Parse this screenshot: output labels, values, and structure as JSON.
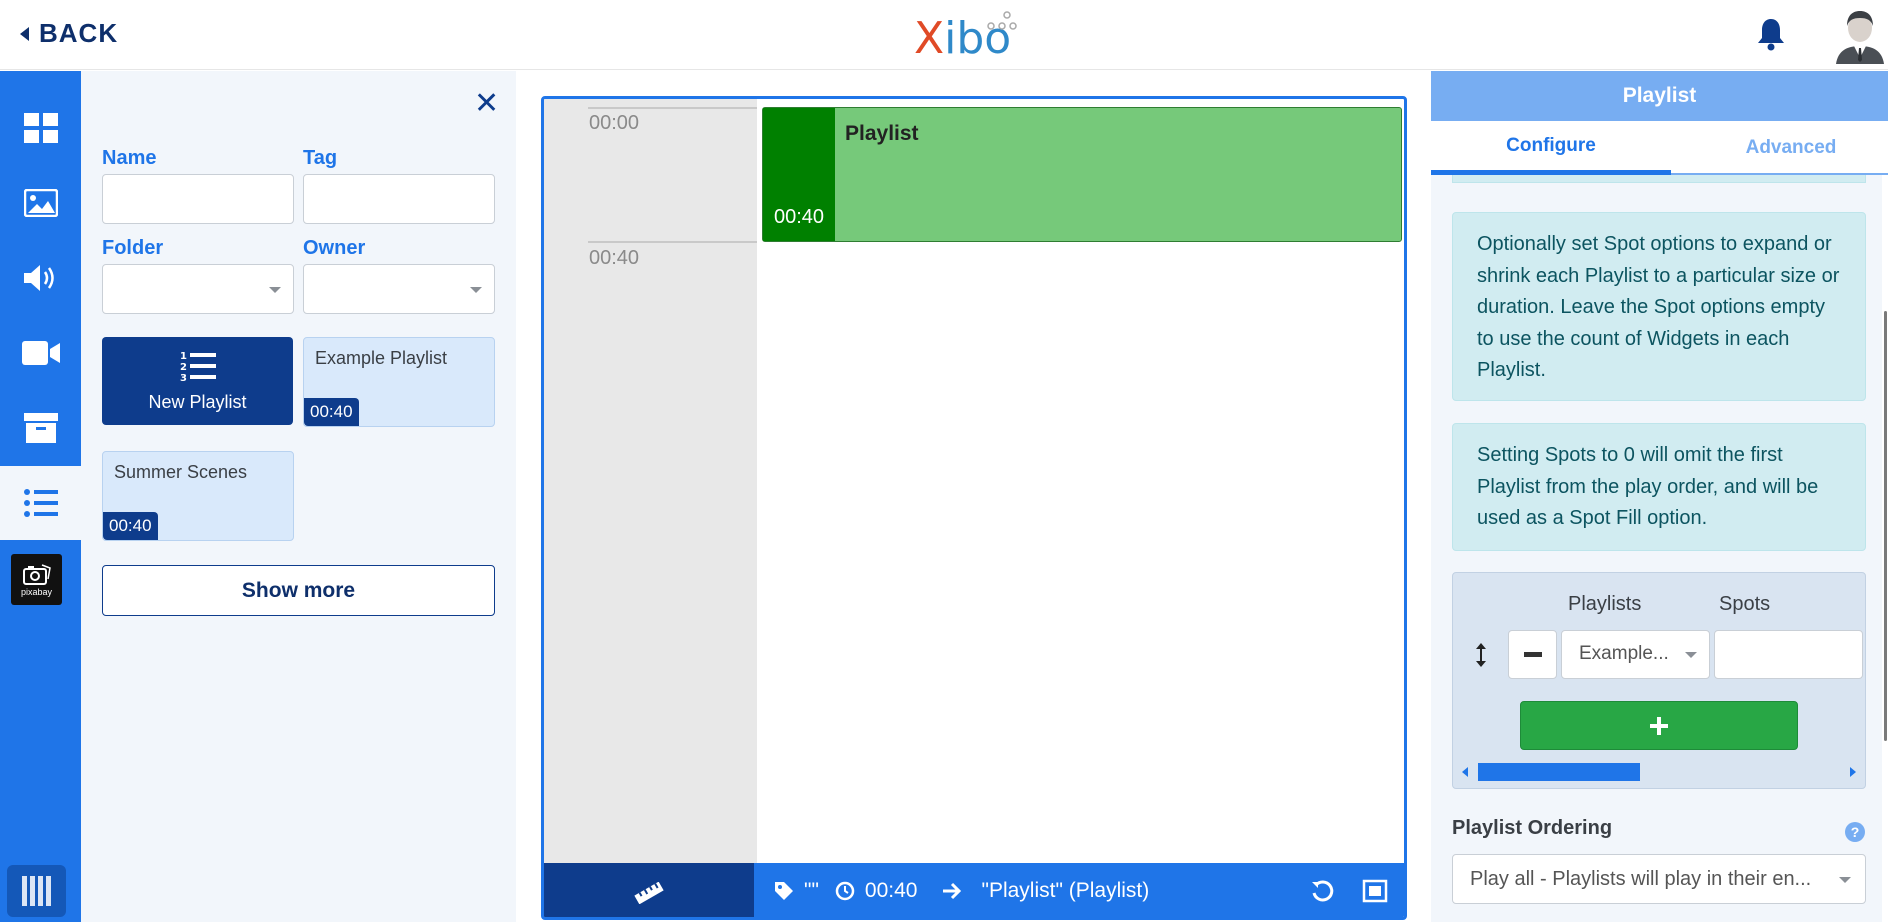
{
  "header": {
    "back_label": "BACK",
    "logo_x": "X",
    "logo_rest": "ibo"
  },
  "sidebar": {
    "items": [
      {
        "name": "widgets",
        "icon": "grid-icon"
      },
      {
        "name": "images",
        "icon": "image-icon"
      },
      {
        "name": "audio",
        "icon": "speaker-icon"
      },
      {
        "name": "video",
        "icon": "video-camera-icon"
      },
      {
        "name": "library",
        "icon": "archive-icon"
      },
      {
        "name": "playlists",
        "icon": "list-icon",
        "active": true
      }
    ],
    "pixabay_label": "pixabay"
  },
  "library": {
    "name_label": "Name",
    "tag_label": "Tag",
    "folder_label": "Folder",
    "owner_label": "Owner",
    "name_value": "",
    "tag_value": "",
    "new_playlist_label": "New Playlist",
    "cards": [
      {
        "title": "Example Playlist",
        "duration": "00:40"
      },
      {
        "title": "Summer Scenes",
        "duration": "00:40"
      }
    ],
    "show_more_label": "Show more"
  },
  "timeline": {
    "ticks": [
      "00:00",
      "00:40"
    ],
    "block": {
      "title": "Playlist",
      "duration": "00:40"
    },
    "bar": {
      "tag_text": "\"\"",
      "duration": "00:40",
      "target": "\"Playlist\" (Playlist)"
    }
  },
  "properties": {
    "title": "Playlist",
    "tabs": [
      {
        "label": "Configure",
        "active": true
      },
      {
        "label": "Advanced",
        "active": false
      }
    ],
    "alert1": "Optionally set Spot options to expand or shrink each Playlist to a particular size or duration. Leave the Spot options empty to use the count of Widgets in each Playlist.",
    "alert2": "Setting Spots to 0 will omit the first Playlist from the play order, and will be used as a Spot Fill option.",
    "spots": {
      "playlists_header": "Playlists",
      "spots_header": "Spots",
      "selected_playlist": "Example...",
      "spots_value": ""
    },
    "ordering_label": "Playlist Ordering",
    "ordering_value": "Play all - Playlists will play in their en..."
  },
  "colors": {
    "primary": "#1f75e8",
    "dark_blue": "#0e3c8c",
    "light_blue": "#77adf2",
    "green_block": "#76c97a",
    "green_dark": "#008000",
    "add_green": "#28a745",
    "alert_bg": "#d1ecf1"
  }
}
